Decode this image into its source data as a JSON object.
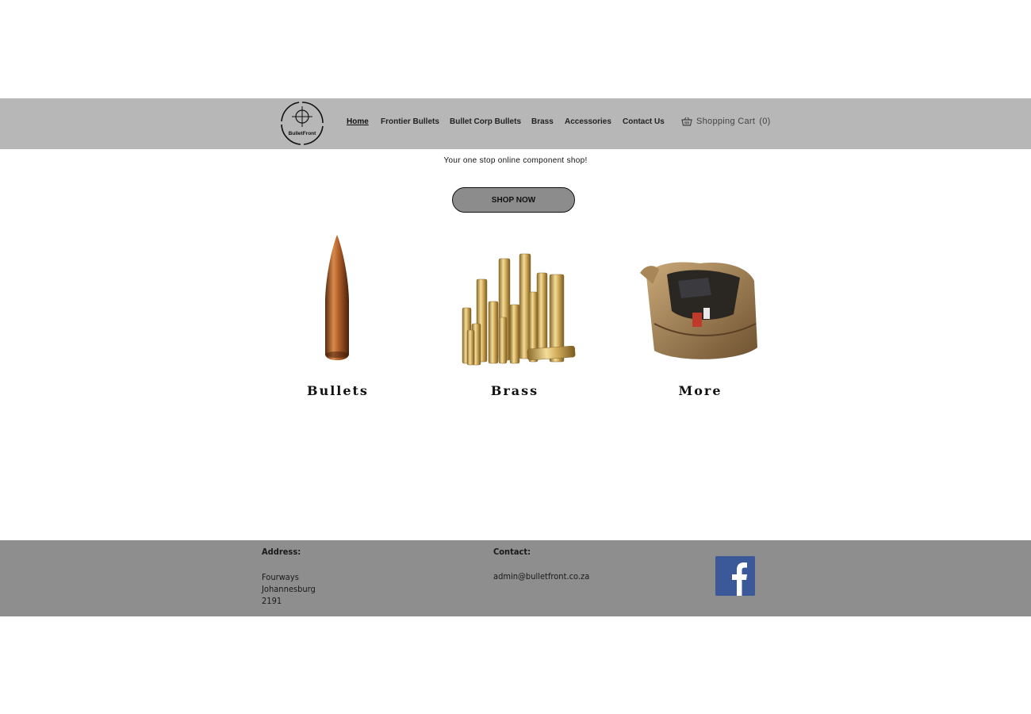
{
  "header": {
    "logo_text": "BulletFront",
    "nav": [
      {
        "label": "Home",
        "active": true
      },
      {
        "label": "Frontier Bullets"
      },
      {
        "label": "Bullet Corp Bullets"
      },
      {
        "label": "Brass"
      },
      {
        "label": "Accessories"
      },
      {
        "label": "Contact Us"
      }
    ],
    "cart_label": "Shopping Cart",
    "cart_count": "(0)"
  },
  "hero": {
    "tagline": "Your one stop online component shop!",
    "cta_label": "SHOP NOW"
  },
  "products": [
    {
      "title": "Bullets",
      "icon": "bullet-image"
    },
    {
      "title": "Brass",
      "icon": "brass-cases-image"
    },
    {
      "title": "More",
      "icon": "range-bag-image"
    }
  ],
  "footer": {
    "address_heading": "Address:",
    "address_lines": [
      "Fourways",
      "Johannesburg",
      "2191"
    ],
    "contact_heading": "Contact:",
    "email": "admin@bulletfront.co.za",
    "social_icon": "facebook-icon"
  },
  "colors": {
    "header_bg": "#b7b7b7",
    "footer_bg": "#8e8e8e",
    "button_bg": "#8c8c8c",
    "facebook_blue": "#3b5998"
  }
}
